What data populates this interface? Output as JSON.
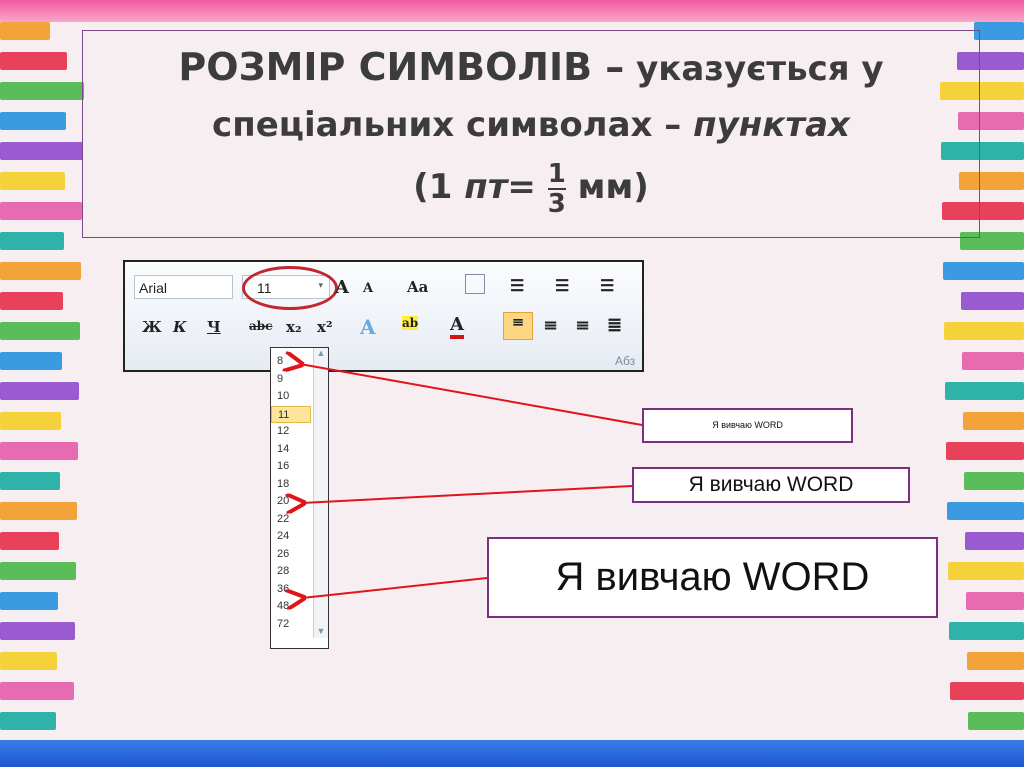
{
  "title": {
    "bold_caps": "РОЗМІР СИМВОЛІВ –",
    "line1_rest": " указується у",
    "line2_start": "спеціальних символах – ",
    "line2_italic": "пунктах",
    "line3_start": "(1 ",
    "line3_italic": "пт",
    "line3_eq": "= ",
    "frac_num": "1",
    "frac_den": "3",
    "line3_end": " мм)"
  },
  "ribbon": {
    "font": "Arial",
    "size": "11",
    "grow": "A",
    "shrink": "A",
    "case": "Aa",
    "bold": "Ж",
    "italic": "К",
    "underline": "Ч",
    "strike": "abc",
    "sub": "x₂",
    "sup": "x²",
    "highlight": "ab",
    "color": "A",
    "group": "Абз"
  },
  "dropdown": {
    "items": [
      "8",
      "9",
      "10",
      "11",
      "12",
      "14",
      "16",
      "18",
      "20",
      "22",
      "24",
      "26",
      "28",
      "36",
      "48",
      "72"
    ],
    "selected": "11"
  },
  "samples": [
    {
      "text": "Я вивчаю WORD",
      "size": "8"
    },
    {
      "text": "Я вивчаю WORD",
      "size": "20"
    },
    {
      "text": "Я вивчаю WORD",
      "size": "36"
    }
  ],
  "colors": {
    "accent": "#c0282d",
    "border": "#7a2f7f"
  }
}
